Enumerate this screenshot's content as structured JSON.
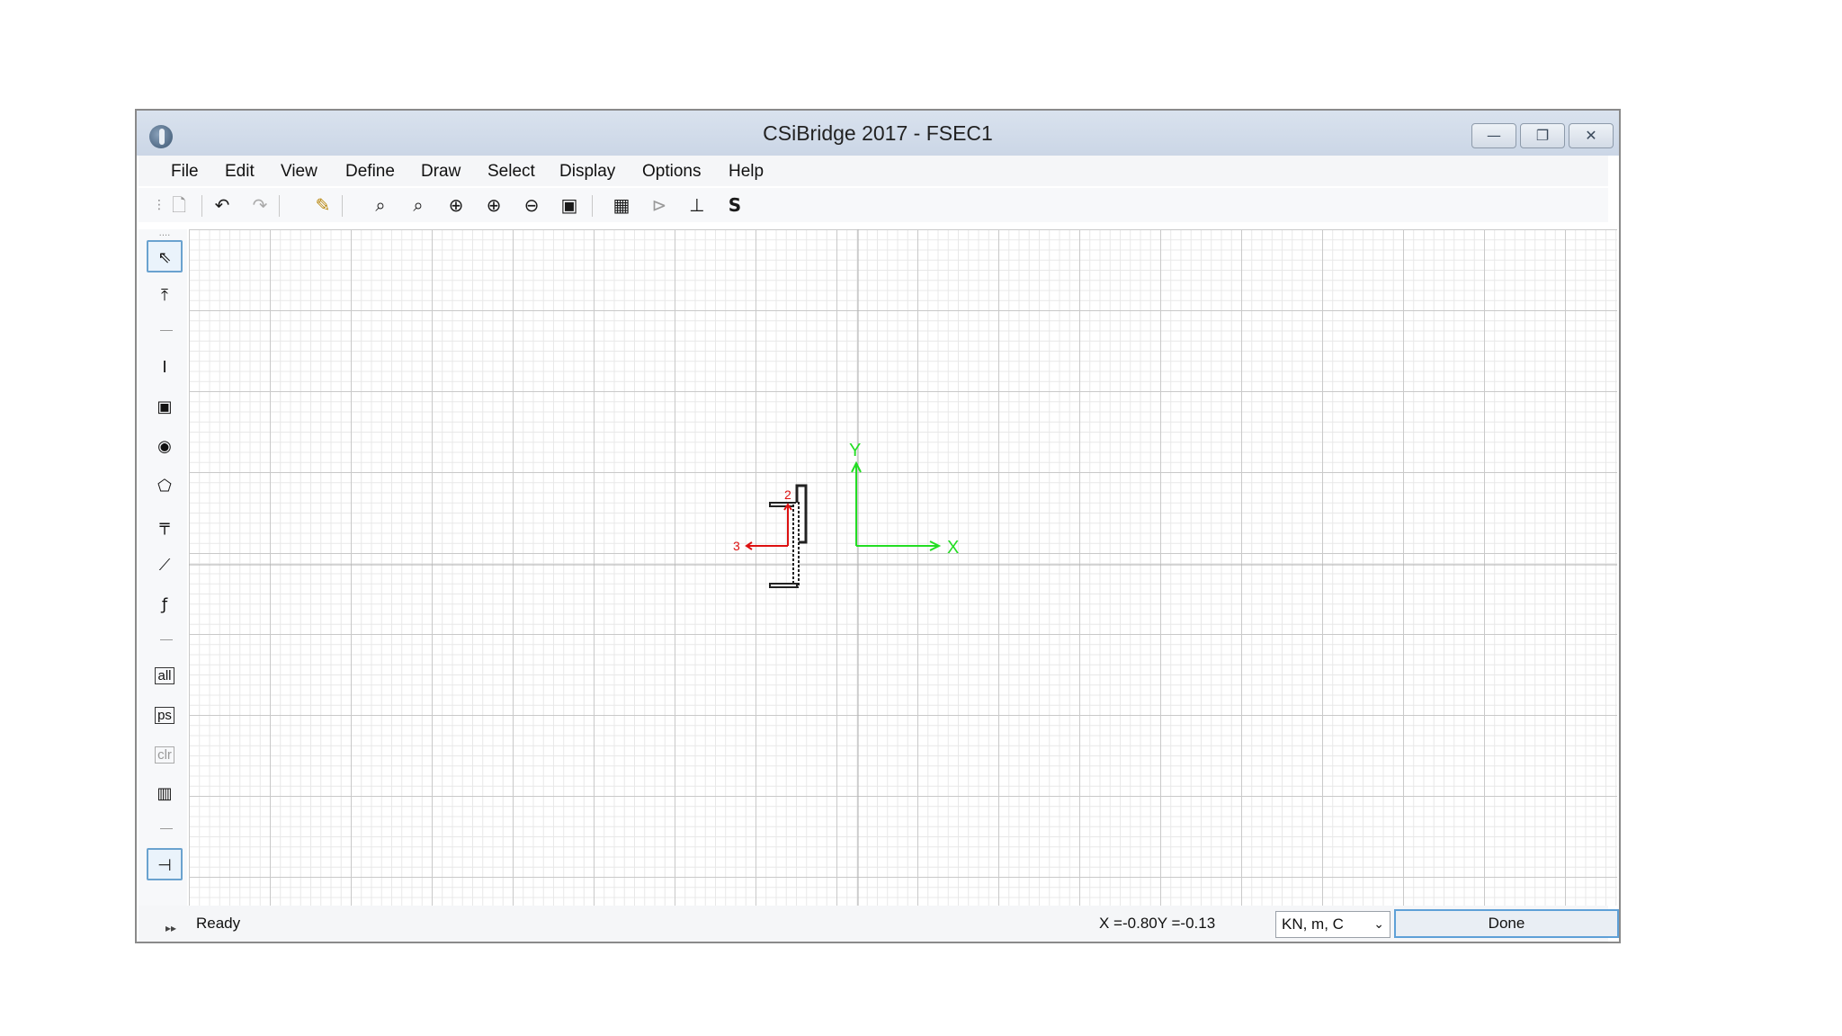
{
  "window": {
    "title": "CSiBridge 2017 - FSEC1"
  },
  "window_buttons": {
    "minimize": "—",
    "restore": "❐",
    "close": "✕"
  },
  "menu": [
    "File",
    "Edit",
    "View",
    "Define",
    "Draw",
    "Select",
    "Display",
    "Options",
    "Help"
  ],
  "toolbar_icons": [
    "new-file-icon",
    "undo-icon",
    "redo-icon",
    "pencil-icon",
    "zoom-rubber-band-icon",
    "zoom-restore-icon",
    "zoom-in-icon",
    "zoom-out-icon",
    "zoom-pan-icon",
    "zoom-window-icon",
    "table-icon",
    "section-properties-icon",
    "coordinate-axes-icon",
    "s-icon"
  ],
  "sidebar_icons": [
    "select-pointer-icon",
    "reshape-icon",
    "draw-line-icon",
    "draw-rectangle-icon",
    "draw-circle-icon",
    "draw-polygon-icon",
    "draw-reinforcement-icon",
    "draw-line-bars-icon",
    "draw-pen-icon",
    "select-all-icon",
    "previous-selection-icon",
    "clear-selection-icon",
    "snap-icon",
    "snap-to-point-icon"
  ],
  "sidebar_labels": {
    "all": "all",
    "ps": "ps",
    "clr": "clr"
  },
  "drawing": {
    "axis_x_label": "X",
    "axis_y_label": "Y",
    "local_axis_2_label": "2",
    "local_axis_3_label": "3",
    "axis_color": "#22dd22",
    "local_axis_color": "#dd1111"
  },
  "status": {
    "ready": "Ready",
    "coords": "X =-0.80Y =-0.13",
    "units": "KN, m, C",
    "done": "Done"
  }
}
